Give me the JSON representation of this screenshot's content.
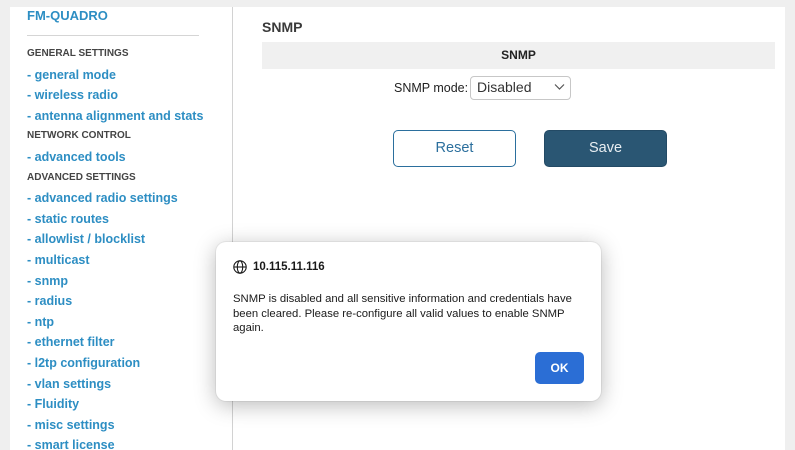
{
  "sidebar": {
    "brand": "FM-QUADRO",
    "items": [
      {
        "type": "section",
        "name": "section-general-settings",
        "label": "GENERAL SETTINGS"
      },
      {
        "type": "link",
        "name": "nav-general-mode",
        "label": "- general mode"
      },
      {
        "type": "link",
        "name": "nav-wireless-radio",
        "label": "- wireless radio"
      },
      {
        "type": "link",
        "name": "nav-antenna-alignment",
        "label": "- antenna alignment and stats"
      },
      {
        "type": "section",
        "name": "section-network-control",
        "label": "NETWORK CONTROL"
      },
      {
        "type": "link",
        "name": "nav-advanced-tools",
        "label": "- advanced tools"
      },
      {
        "type": "section",
        "name": "section-advanced-settings",
        "label": "ADVANCED SETTINGS"
      },
      {
        "type": "link",
        "name": "nav-advanced-radio-settings",
        "label": "- advanced radio settings"
      },
      {
        "type": "link",
        "name": "nav-static-routes",
        "label": "- static routes"
      },
      {
        "type": "link",
        "name": "nav-allowlist-blocklist",
        "label": "- allowlist / blocklist"
      },
      {
        "type": "link",
        "name": "nav-multicast",
        "label": "- multicast"
      },
      {
        "type": "link",
        "name": "nav-snmp",
        "label": "- snmp"
      },
      {
        "type": "link",
        "name": "nav-radius",
        "label": "- radius"
      },
      {
        "type": "link",
        "name": "nav-ntp",
        "label": "- ntp"
      },
      {
        "type": "link",
        "name": "nav-ethernet-filter",
        "label": "- ethernet filter"
      },
      {
        "type": "link",
        "name": "nav-l2tp-configuration",
        "label": "- l2tp configuration"
      },
      {
        "type": "link",
        "name": "nav-vlan-settings",
        "label": "- vlan settings"
      },
      {
        "type": "link",
        "name": "nav-fluidity",
        "label": "- Fluidity"
      },
      {
        "type": "link",
        "name": "nav-misc-settings",
        "label": "- misc settings"
      },
      {
        "type": "link",
        "name": "nav-smart-license",
        "label": "- smart license"
      }
    ]
  },
  "main": {
    "title": "SNMP",
    "section_header": "SNMP",
    "mode_label": "SNMP mode:",
    "mode_value": "Disabled",
    "reset_label": "Reset",
    "save_label": "Save"
  },
  "modal": {
    "host": "10.115.11.116",
    "message": "SNMP is disabled and all sensitive information and credentials have been cleared. Please re-configure all valid values to enable SNMP again.",
    "ok_label": "OK"
  },
  "icons": {
    "globe": "globe-icon",
    "select_arrow": "chevron-down-icon"
  },
  "colors": {
    "link": "#2d8ec3",
    "save_button": "#2a5673",
    "reset_border": "#2b6f9d",
    "ok_button": "#2b6ed5"
  }
}
